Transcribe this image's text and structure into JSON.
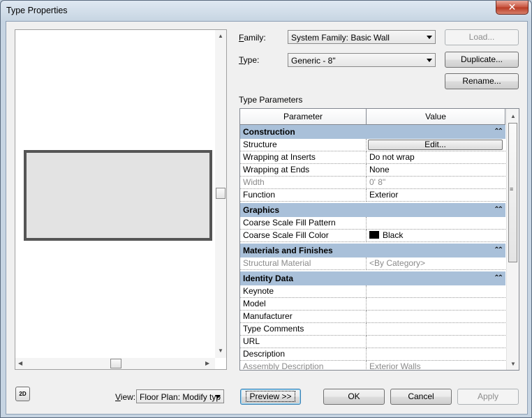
{
  "window": {
    "title": "Type Properties",
    "close_glyph": "✕"
  },
  "family": {
    "label": "Family:",
    "value": "System Family: Basic Wall",
    "load_button": "Load..."
  },
  "type": {
    "label": "Type:",
    "value": "Generic - 8\"",
    "duplicate_button": "Duplicate...",
    "rename_button": "Rename..."
  },
  "params": {
    "section_label": "Type Parameters",
    "col_parameter": "Parameter",
    "col_value": "Value",
    "groups": [
      {
        "name": "Construction",
        "rows": [
          {
            "param": "Structure",
            "value": "Edit...",
            "kind": "button"
          },
          {
            "param": "Wrapping at Inserts",
            "value": "Do not wrap"
          },
          {
            "param": "Wrapping at Ends",
            "value": "None"
          },
          {
            "param": "Width",
            "value": "0'  8\"",
            "gray": true
          },
          {
            "param": "Function",
            "value": "Exterior"
          }
        ]
      },
      {
        "name": "Graphics",
        "rows": [
          {
            "param": "Coarse Scale Fill Pattern",
            "value": ""
          },
          {
            "param": "Coarse Scale Fill Color",
            "value": "Black",
            "kind": "color",
            "color": "#000000"
          }
        ]
      },
      {
        "name": "Materials and Finishes",
        "rows": [
          {
            "param": "Structural Material",
            "value": "<By Category>",
            "gray": true
          }
        ]
      },
      {
        "name": "Identity Data",
        "rows": [
          {
            "param": "Keynote",
            "value": ""
          },
          {
            "param": "Model",
            "value": ""
          },
          {
            "param": "Manufacturer",
            "value": ""
          },
          {
            "param": "Type Comments",
            "value": ""
          },
          {
            "param": "URL",
            "value": ""
          },
          {
            "param": "Description",
            "value": ""
          },
          {
            "param": "Assembly Description",
            "value": "Exterior Walls",
            "gray": true
          }
        ]
      }
    ]
  },
  "footer": {
    "view_label": "View:",
    "view_value": "Floor Plan: Modify typ",
    "preview_button": "Preview >>",
    "ok_button": "OK",
    "cancel_button": "Cancel",
    "apply_button": "Apply",
    "icon_2d_text": "2D"
  }
}
